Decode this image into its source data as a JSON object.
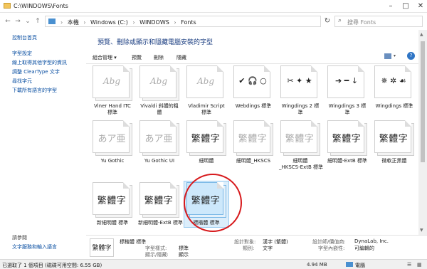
{
  "window": {
    "title": "C:\\WINDOWS\\Fonts"
  },
  "address": {
    "crumbs": [
      "本機",
      "Windows (C:)",
      "WINDOWS",
      "Fonts"
    ]
  },
  "search": {
    "placeholder": "搜尋 Fonts"
  },
  "sidebar": {
    "links": [
      "控制台首頁",
      "字型設定",
      "線上取得其他字型的資訊",
      "調整 ClearType 文字",
      "尋找字元",
      "下載所有語言的字型"
    ],
    "see_also_heading": "請參閱",
    "see_also_links": [
      "文字服務和輸入語言"
    ]
  },
  "main": {
    "title": "預覽、刪除或顯示和隱藏電腦安裝的字型",
    "toolbar": [
      "組合管理 ▾",
      "預覽",
      "刪除",
      "隱藏"
    ]
  },
  "fonts": [
    {
      "name": "Viner Hand ITC",
      "sub": "標準",
      "sample": "Abg",
      "style": "script"
    },
    {
      "name": "Vivaldi 斜體的粗",
      "sub": "體",
      "sample": "Abg",
      "style": "script"
    },
    {
      "name": "Vladimir Script",
      "sub": "標準",
      "sample": "Abg",
      "style": "script"
    },
    {
      "name": "Webdings 標準",
      "sub": "",
      "sample": "✔ 🎧 ○",
      "style": "symbol"
    },
    {
      "name": "Wingdings 2 標",
      "sub": "準",
      "sample": "✂ ✦ ★",
      "style": "symbol"
    },
    {
      "name": "Wingdings 3 標",
      "sub": "準",
      "sample": "➔ ━ ↓",
      "style": "symbol"
    },
    {
      "name": "Wingdings 標準",
      "sub": "",
      "sample": "✵ ✲ ☙",
      "style": "symbol"
    },
    {
      "name": "Yu Gothic",
      "sub": "",
      "sample": "あア亜",
      "style": "grey"
    },
    {
      "name": "Yu Gothic UI",
      "sub": "",
      "sample": "あア亜",
      "style": "grey"
    },
    {
      "name": "細明體",
      "sub": "",
      "sample": "繁體字",
      "style": "cjk"
    },
    {
      "name": "細明體_HKSCS",
      "sub": "",
      "sample": "繁體字",
      "style": "cjk-grey"
    },
    {
      "name": "細明體",
      "sub": "_HKSCS-ExtB 標準",
      "sample": "繁體字",
      "style": "cjk-grey"
    },
    {
      "name": "細明體-ExtB 標準",
      "sub": "",
      "sample": "繁體字",
      "style": "cjk"
    },
    {
      "name": "微軟正黑體",
      "sub": "",
      "sample": "繁體字",
      "style": "cjk"
    },
    {
      "name": "新細明體 標準",
      "sub": "",
      "sample": "繁體字",
      "style": "cjk"
    },
    {
      "name": "新細明體-ExtB 標準",
      "sub": "",
      "sample": "繁體字",
      "style": "cjk"
    },
    {
      "name": "標楷體 標準",
      "sub": "",
      "sample": "繁體字",
      "style": "cjk-selected"
    }
  ],
  "details": {
    "sample": "繁體字",
    "name": "標楷體 標準",
    "style_label": "字型樣式:",
    "style_value": "標準",
    "visibility_label": "顯示/隱藏:",
    "visibility_value": "顯示",
    "designed_for_label": "設計對象:",
    "designed_for_value": "漢字 (繁體)",
    "category_label": "類別:",
    "category_value": "文字",
    "designer_label": "設計師/價值商:",
    "designer_value": "DynaLab, Inc.",
    "embeddability_label": "字型內嵌性:",
    "embeddability_value": "可編輯的"
  },
  "status": {
    "left": "已選取了 1 個項目 (磁碟可用空間: 6.55 GB)",
    "size": "4.94 MB",
    "location": "電腦"
  }
}
